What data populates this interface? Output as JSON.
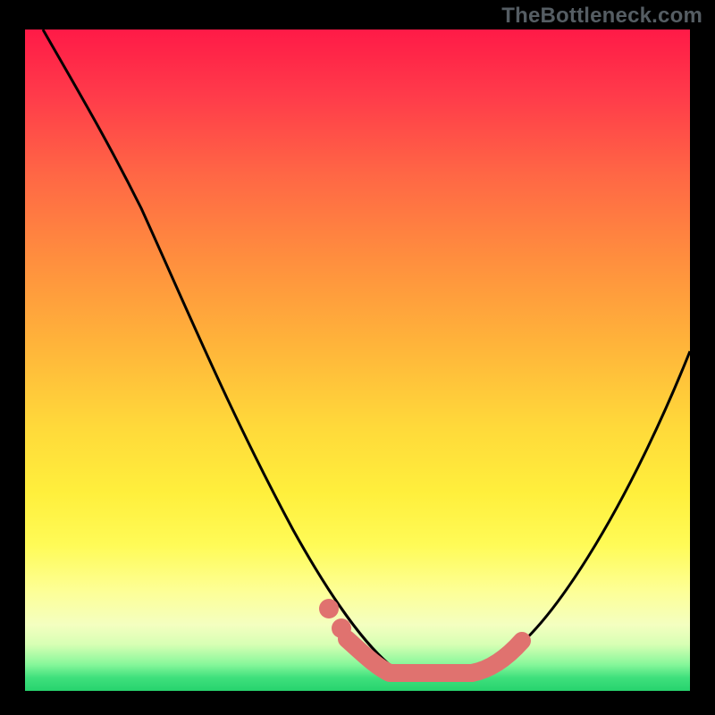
{
  "watermark": "TheBottleneck.com",
  "chart_data": {
    "type": "line",
    "title": "",
    "xlabel": "",
    "ylabel": "",
    "xlim": [
      0,
      100
    ],
    "ylim": [
      0,
      100
    ],
    "series": [
      {
        "name": "bottleneck-curve",
        "x": [
          3,
          10,
          20,
          30,
          40,
          48,
          52,
          56,
          60,
          64,
          68,
          75,
          85,
          95,
          100
        ],
        "y": [
          100,
          88,
          70,
          52,
          35,
          18,
          10,
          4,
          2,
          2,
          2,
          4,
          14,
          32,
          42
        ]
      }
    ],
    "highlight": {
      "name": "optimal-range",
      "x": [
        48,
        52,
        56,
        60,
        64,
        68
      ],
      "y": [
        8,
        5,
        2,
        2,
        2,
        4
      ]
    },
    "gradient_stops": [
      {
        "pos": 0,
        "color": "#ff1a47"
      },
      {
        "pos": 50,
        "color": "#ffd93a"
      },
      {
        "pos": 90,
        "color": "#f4ffc0"
      },
      {
        "pos": 100,
        "color": "#27d36e"
      }
    ]
  }
}
